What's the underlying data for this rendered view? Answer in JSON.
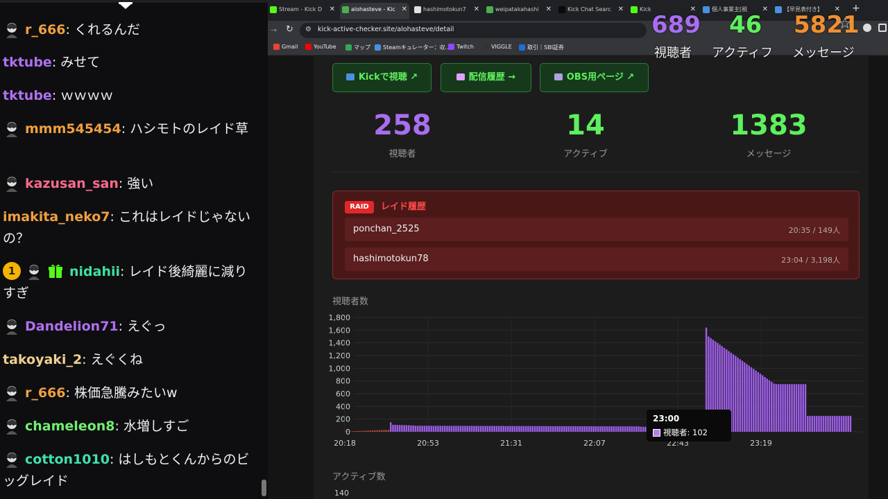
{
  "chat": {
    "messages": [
      {
        "user": "r_666",
        "color": "#f0a040",
        "avatar": true,
        "text": ": くれるんだ"
      },
      {
        "user": "tktube",
        "color": "#b070f0",
        "avatar": false,
        "text": ": みせて"
      },
      {
        "user": "tktube",
        "color": "#b070f0",
        "avatar": false,
        "text": ": ｗｗｗｗ"
      },
      {
        "user": "mmm545454",
        "color": "#f0a040",
        "avatar": true,
        "text": ": ハシモトのレイド草"
      },
      {
        "user": "kazusan_san",
        "color": "#ff6b8b",
        "avatar": true,
        "text": ": 強い"
      },
      {
        "user": "imakita_neko7",
        "color": "#f0a040",
        "avatar": false,
        "text": ": これはレイドじゃないの？"
      },
      {
        "user": "nidahii",
        "color": "#40e0a0",
        "avatar": true,
        "badge_num": "1",
        "gift": true,
        "text": ": レイド後綺麗に減りすぎ"
      },
      {
        "user": "Dandelion71",
        "color": "#b070f0",
        "avatar": true,
        "text": ": えぐっ"
      },
      {
        "user": "takoyaki_2",
        "color": "#f0d090",
        "avatar": false,
        "text": ": えぐくね"
      },
      {
        "user": "r_666",
        "color": "#f0a040",
        "avatar": true,
        "text": ": 株価急騰みたいw"
      },
      {
        "user": "chameleon8",
        "color": "#70f070",
        "avatar": true,
        "text": ": 水増しすご"
      },
      {
        "user": "cotton1010",
        "color": "#40e0b0",
        "avatar": true,
        "text": ": はしもとくんからのビッグレイド"
      }
    ]
  },
  "browser": {
    "tabs": [
      {
        "label": "Stream - Kick D",
        "fav": "#53fc18",
        "active": false
      },
      {
        "label": "alohasteve - Kic",
        "fav": "#4caf50",
        "active": true
      },
      {
        "label": "hashimotokun7",
        "fav": "#e0e0e0",
        "active": false
      },
      {
        "label": "weipatakahashi",
        "fav": "#4caf50",
        "active": false
      },
      {
        "label": "Kick Chat Searc",
        "fav": "#0a0a0a",
        "active": false
      },
      {
        "label": "Kick",
        "fav": "#53fc18",
        "active": false
      },
      {
        "label": "個人事業主[税",
        "fav": "#4a90e2",
        "active": false
      },
      {
        "label": "【早見表付き】",
        "fav": "#4a90e2",
        "active": false
      }
    ],
    "url": "kick-active-checker.site/alohasteve/detail",
    "bookmarks": [
      {
        "label": "Gmail",
        "color": "#ea4335"
      },
      {
        "label": "YouTube",
        "color": "#ff0000"
      },
      {
        "label": "マップ",
        "color": "#34a853"
      },
      {
        "label": "Steamキュレーター：収...",
        "color": "#4a90e2"
      },
      {
        "label": "Twitch",
        "color": "#9146ff"
      },
      {
        "label": "VIGGLE",
        "color": "#333333"
      },
      {
        "label": "取引｜SBI証券",
        "color": "#1e6fd9"
      }
    ]
  },
  "overlay": {
    "viewers": "689",
    "viewers_label": "視聴者",
    "active": "46",
    "active_label": "アクティフ",
    "messages": "5821",
    "messages_label": "メッセージ"
  },
  "page": {
    "buttons": [
      {
        "label": "Kickで視聴 ↗",
        "icon": "#4a90e2"
      },
      {
        "label": "配信履歴 →",
        "icon": "#e0a0ff"
      },
      {
        "label": "OBS用ページ ↗",
        "icon": "#b0a0e0"
      }
    ],
    "stats": [
      {
        "value": "258",
        "label": "視聴者",
        "color": "#a86ef0"
      },
      {
        "value": "14",
        "label": "アクティブ",
        "color": "#5ef05e"
      },
      {
        "value": "1383",
        "label": "メッセージ",
        "color": "#5ef05e"
      }
    ],
    "raid": {
      "badge": "RAID",
      "title": "レイド履歴",
      "rows": [
        {
          "name": "ponchan_2525",
          "meta": "20:35 / 149人"
        },
        {
          "name": "hashimotokun78",
          "meta": "23:04 / 3,198人"
        }
      ]
    },
    "viewer_chart_title": "視聴者数",
    "active_chart_title": "アクティブ数",
    "active_chart_top_tick": "140",
    "tooltip": {
      "time": "23:00",
      "label": "視聴者: 102"
    }
  },
  "chart_data": {
    "type": "bar",
    "title": "視聴者数",
    "x_ticks": [
      "20:18",
      "20:53",
      "21:31",
      "22:07",
      "22:43",
      "23:19"
    ],
    "y_ticks": [
      "0",
      "200",
      "400",
      "600",
      "800",
      "1,000",
      "1,200",
      "1,400",
      "1,600",
      "1,800"
    ],
    "ylim": [
      0,
      1800
    ],
    "grid": true,
    "segments": [
      {
        "count": 20,
        "from": 5,
        "to": 30,
        "color": "#b0463c"
      },
      {
        "count": 1,
        "from": 150,
        "to": 150,
        "color": "#9b5de5"
      },
      {
        "count": 10,
        "from": 110,
        "to": 100,
        "color": "#9b5de5"
      },
      {
        "count": 100,
        "from": 95,
        "to": 85,
        "color": "#9b5de5"
      },
      {
        "count": 12,
        "from": 80,
        "to": 70,
        "color": "#9b5de5"
      },
      {
        "count": 6,
        "from": 80,
        "to": 100,
        "color": "#c0392b"
      },
      {
        "count": 6,
        "from": 100,
        "to": 102,
        "color": "#9b5de5"
      },
      {
        "count": 5,
        "from": 100,
        "to": 100,
        "color": "#d03030"
      },
      {
        "count": 1,
        "from": 1640,
        "to": 1640,
        "color": "#9b5de5"
      },
      {
        "count": 30,
        "from": 1500,
        "to": 760,
        "color": "#9b5de5"
      },
      {
        "count": 14,
        "from": 750,
        "to": 750,
        "color": "#9b5de5"
      },
      {
        "count": 20,
        "from": 250,
        "to": 250,
        "color": "#9b5de5"
      }
    ]
  }
}
